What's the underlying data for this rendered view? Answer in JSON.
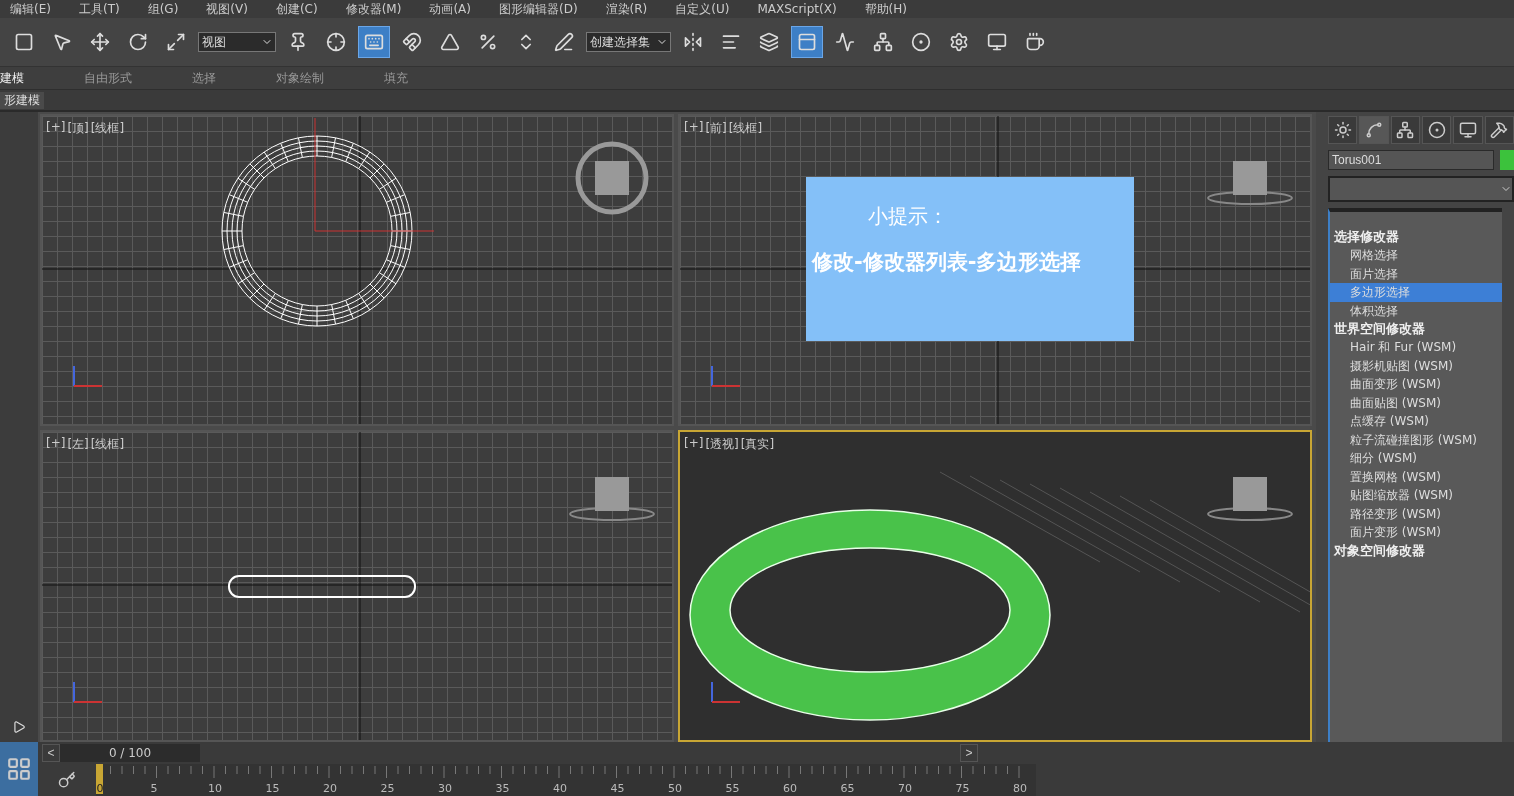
{
  "menu": [
    {
      "label": "编辑(E)"
    },
    {
      "label": "工具(T)"
    },
    {
      "label": "组(G)"
    },
    {
      "label": "视图(V)"
    },
    {
      "label": "创建(C)"
    },
    {
      "label": "修改器(M)"
    },
    {
      "label": "动画(A)"
    },
    {
      "label": "图形编辑器(D)"
    },
    {
      "label": "渲染(R)"
    },
    {
      "label": "自定义(U)"
    },
    {
      "label": "MAXScript(X)"
    },
    {
      "label": "帮助(H)"
    }
  ],
  "toolbar": [
    {
      "kind": "tool",
      "selected": false
    },
    {
      "kind": "tool",
      "selected": false
    },
    {
      "kind": "tool",
      "selected": false
    },
    {
      "kind": "tool",
      "selected": false
    },
    {
      "kind": "tool",
      "selected": false
    },
    {
      "kind": "dropdown",
      "value": "视图"
    },
    {
      "kind": "tool",
      "selected": false
    },
    {
      "kind": "tool",
      "selected": false
    },
    {
      "kind": "tool",
      "selected": true
    },
    {
      "kind": "tool",
      "selected": false
    },
    {
      "kind": "tool",
      "selected": false
    },
    {
      "kind": "tool",
      "selected": false
    },
    {
      "kind": "tool",
      "selected": false
    },
    {
      "kind": "tool",
      "selected": false
    },
    {
      "kind": "dropdown",
      "value": "创建选择集"
    },
    {
      "kind": "tool",
      "selected": false
    },
    {
      "kind": "tool",
      "selected": false
    },
    {
      "kind": "tool",
      "selected": false
    },
    {
      "kind": "tool",
      "selected": true
    },
    {
      "kind": "tool",
      "selected": false
    },
    {
      "kind": "tool",
      "selected": false
    },
    {
      "kind": "tool",
      "selected": false
    },
    {
      "kind": "tool",
      "selected": false
    },
    {
      "kind": "tool",
      "selected": false
    },
    {
      "kind": "tool",
      "selected": false
    }
  ],
  "ribbon_tabs": [
    {
      "label": "建模",
      "selected": true
    },
    {
      "label": "自由形式",
      "selected": false
    },
    {
      "label": "选择",
      "selected": false
    },
    {
      "label": "对象绘制",
      "selected": false
    },
    {
      "label": "填充",
      "selected": false
    }
  ],
  "ribbon_panel": {
    "label": "形建模"
  },
  "viewports": [
    {
      "kind": "top",
      "plus": "[+]",
      "view": "[顶]",
      "shading": "[线框]",
      "active": false
    },
    {
      "kind": "front",
      "plus": "[+]",
      "view": "[前]",
      "shading": "[线框]",
      "active": false
    },
    {
      "kind": "left",
      "plus": "[+]",
      "view": "[左]",
      "shading": "[线框]",
      "active": false
    },
    {
      "kind": "perspective",
      "plus": "[+]",
      "view": "[透视]",
      "shading": "[真实]",
      "active": true
    }
  ],
  "hint": {
    "title": "小提示：",
    "text": "修改-修改器列表-多边形选择"
  },
  "command_panel": {
    "tabs": [
      {
        "selected": false
      },
      {
        "selected": true
      },
      {
        "selected": false
      },
      {
        "selected": false
      },
      {
        "selected": false
      },
      {
        "selected": false
      }
    ],
    "object": {
      "name": "Torus001",
      "color": "#3cc23c"
    },
    "modifier_groups": [
      {
        "title": "选择修改器",
        "items": [
          {
            "label": "网格选择",
            "selected": false
          },
          {
            "label": "面片选择",
            "selected": false
          },
          {
            "label": "多边形选择",
            "selected": true
          },
          {
            "label": "体积选择",
            "selected": false
          }
        ]
      },
      {
        "title": "世界空间修改器",
        "items": [
          {
            "label": "Hair 和 Fur (WSM)",
            "selected": false
          },
          {
            "label": "摄影机贴图 (WSM)",
            "selected": false
          },
          {
            "label": "曲面变形 (WSM)",
            "selected": false
          },
          {
            "label": "曲面贴图 (WSM)",
            "selected": false
          },
          {
            "label": "点缓存 (WSM)",
            "selected": false
          },
          {
            "label": "粒子流碰撞图形 (WSM)",
            "selected": false
          },
          {
            "label": "细分 (WSM)",
            "selected": false
          },
          {
            "label": "置换网格 (WSM)",
            "selected": false
          },
          {
            "label": "贴图缩放器 (WSM)",
            "selected": false
          },
          {
            "label": "路径变形 (WSM)",
            "selected": false
          },
          {
            "label": "面片变形 (WSM)",
            "selected": false
          }
        ]
      },
      {
        "title": "对象空间修改器"
      }
    ]
  },
  "timeline": {
    "prev": "<",
    "position": "0 / 100",
    "level": 0,
    "next": ">",
    "current": "0",
    "labels": [
      "5",
      "10",
      "15",
      "20",
      "25",
      "30",
      "35",
      "40",
      "45",
      "50",
      "55",
      "60",
      "65",
      "70",
      "75",
      "80"
    ]
  }
}
